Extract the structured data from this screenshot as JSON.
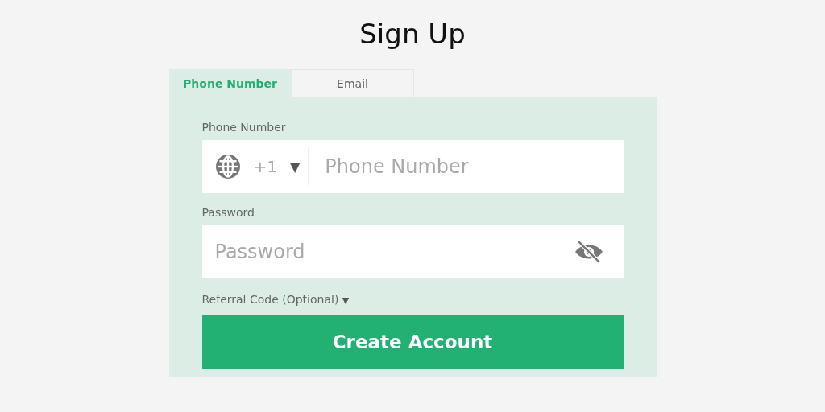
{
  "title": "Sign Up",
  "tabs": [
    {
      "label": "Phone Number",
      "selected": true
    },
    {
      "label": "Email",
      "selected": false
    }
  ],
  "phone": {
    "label": "Phone Number",
    "country_code": "+1",
    "caret": "▼",
    "placeholder": "Phone Number"
  },
  "password": {
    "label": "Password",
    "placeholder": "Password"
  },
  "referral": {
    "label": "Referral Code (Optional)",
    "caret": "▼"
  },
  "submit": "Create Account"
}
